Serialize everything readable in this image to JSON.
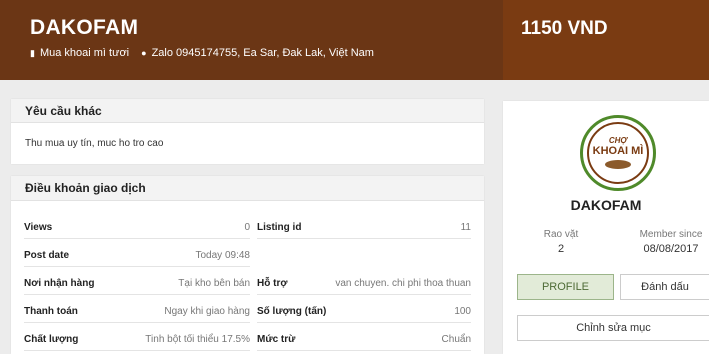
{
  "header": {
    "title": "DAKOFAM",
    "category": "Mua khoai mì tươi",
    "contact": "Zalo 0945174755, Ea Sar, Đak Lak, Việt Nam",
    "price": "1150 VND"
  },
  "request": {
    "heading": "Yêu cầu khác",
    "text": "Thu mua uy tín, muc ho tro cao"
  },
  "terms": {
    "heading": "Điều khoản giao dịch",
    "rows": [
      {
        "k": "Views",
        "v": "0"
      },
      {
        "k": "Post date",
        "v": "Today 09:48"
      },
      {
        "k": "Nơi nhận hàng",
        "v": "Tại kho bên bán"
      },
      {
        "k": "Thanh toán",
        "v": "Ngay khi giao hàng"
      },
      {
        "k": "Chất lượng",
        "v": "Tinh bột tối thiểu 17.5%"
      },
      {
        "k": "Listing id",
        "v": "11"
      },
      {
        "k": "Hỗ trợ",
        "v": "van chuyen. chi phi thoa thuan"
      },
      {
        "k": "Số lượng (tấn)",
        "v": "100"
      },
      {
        "k": "Mức trừ",
        "v": "Chuẩn"
      }
    ]
  },
  "seller": {
    "logo_line1": "CHỢ",
    "logo_line2": "KHOAI MÌ",
    "name": "DAKOFAM",
    "rao_vat_label": "Rao vặt",
    "rao_vat_value": "2",
    "member_since_label": "Member since",
    "member_since_value": "08/08/2017",
    "profile_button": "PROFILE",
    "bookmark_button": "Đánh dấu",
    "edit_button": "Chỉnh sửa mục"
  },
  "colors": {
    "header_bg": "#6b3615",
    "price_bg": "#7a3b12",
    "profile_bg": "#e2ebd8"
  },
  "icons": {
    "category": "bookmark-icon",
    "location": "map-pin-icon"
  }
}
